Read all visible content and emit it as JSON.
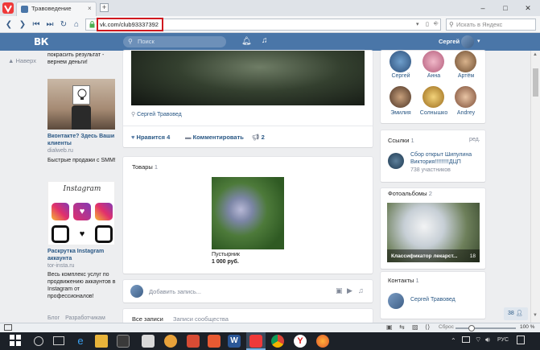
{
  "browser": {
    "tab_title": "Травоведение",
    "tab_close": "×",
    "new_tab": "+",
    "url": "vk.com/club93337392",
    "search_placeholder": "Искать в Яндекс",
    "win_min": "–",
    "win_max": "□",
    "win_close": "✕"
  },
  "vk_header": {
    "logo": "ВК",
    "search_placeholder": "Поиск",
    "user_name": "Сергей"
  },
  "left_column": {
    "back_up": "▲ Наверх",
    "ad1_tail": [
      "покрасить результат -",
      "вернем деньги!"
    ],
    "ad2": {
      "title": "Вконтакте? Здесь Ваши клиенты",
      "domain": "dialweb.ru",
      "text": "Быстрые продажи с SMM!"
    },
    "ad3": {
      "image_caption": "Instagram",
      "title": "Раскрутка Instagram аккаунта",
      "domain": "tor-insta.ru",
      "text": "Весь комплекс услуг по продвижению аккаунтов в Instagram от профессионалов!"
    },
    "footer_links": [
      "Блог",
      "Разработчикам"
    ]
  },
  "center": {
    "post_author": "Сергей Травовед",
    "like_label": "Нравится",
    "like_count": "4",
    "comment_label": "Комментировать",
    "share_count": "2",
    "products_title": "Товары",
    "products_count": "1",
    "product_name": "Пустырник",
    "product_price": "1 000 руб.",
    "new_post_placeholder": "Добавить запись...",
    "tabs": [
      "Все записи",
      "Записи сообщества"
    ]
  },
  "right": {
    "friends": [
      "Сергей",
      "Анна",
      "Артём",
      "Эмилия",
      "Солнышко",
      "Andrey"
    ],
    "links_title": "Ссылки",
    "links_count": "1",
    "links_edit": "ред.",
    "link_name": "Сбор открыт Шипулина Виктория!!!!!!!!!ДЦП",
    "link_members": "738 участников",
    "albums_title": "Фотоальбомы",
    "albums_count": "2",
    "album_name": "Классификатор лекарст...",
    "album_count": "18",
    "contacts_title": "Контакты",
    "contacts_count": "1",
    "contact_name": "Сергей Травовед",
    "chat_count": "38"
  },
  "status": {
    "reset": "Сброс",
    "zoom": "100 %"
  },
  "taskbar": {
    "lang": "РУС"
  },
  "colors": {
    "vk_blue": "#4a76a8",
    "link": "#2a5885",
    "highlight_red": "#d0191f"
  }
}
